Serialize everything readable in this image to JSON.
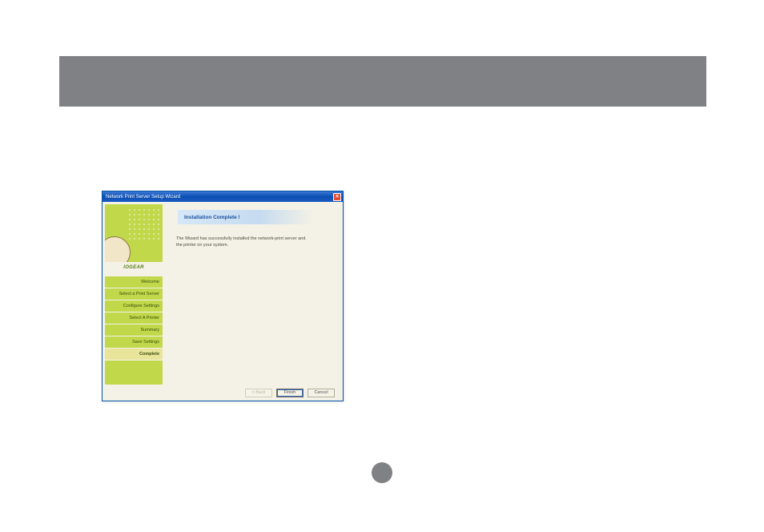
{
  "banner": {},
  "window": {
    "title": "Network Print Server Setup Wizard",
    "close_label": "×"
  },
  "sidebar": {
    "brand": "IOGEAR",
    "items": [
      {
        "label": "Welcome"
      },
      {
        "label": "Select a Print Server"
      },
      {
        "label": "Configure Settings"
      },
      {
        "label": "Select A Printer"
      },
      {
        "label": "Summary"
      },
      {
        "label": "Save Settings"
      },
      {
        "label": "Complete"
      }
    ]
  },
  "main": {
    "heading": "Installation Complete !",
    "body_line1": "The Wizard has successfully installed the network-print server and",
    "body_line2": "the printer on your system."
  },
  "buttons": {
    "back": "< Back",
    "finish": "Finish",
    "cancel": "Cancel"
  },
  "page_number": ""
}
